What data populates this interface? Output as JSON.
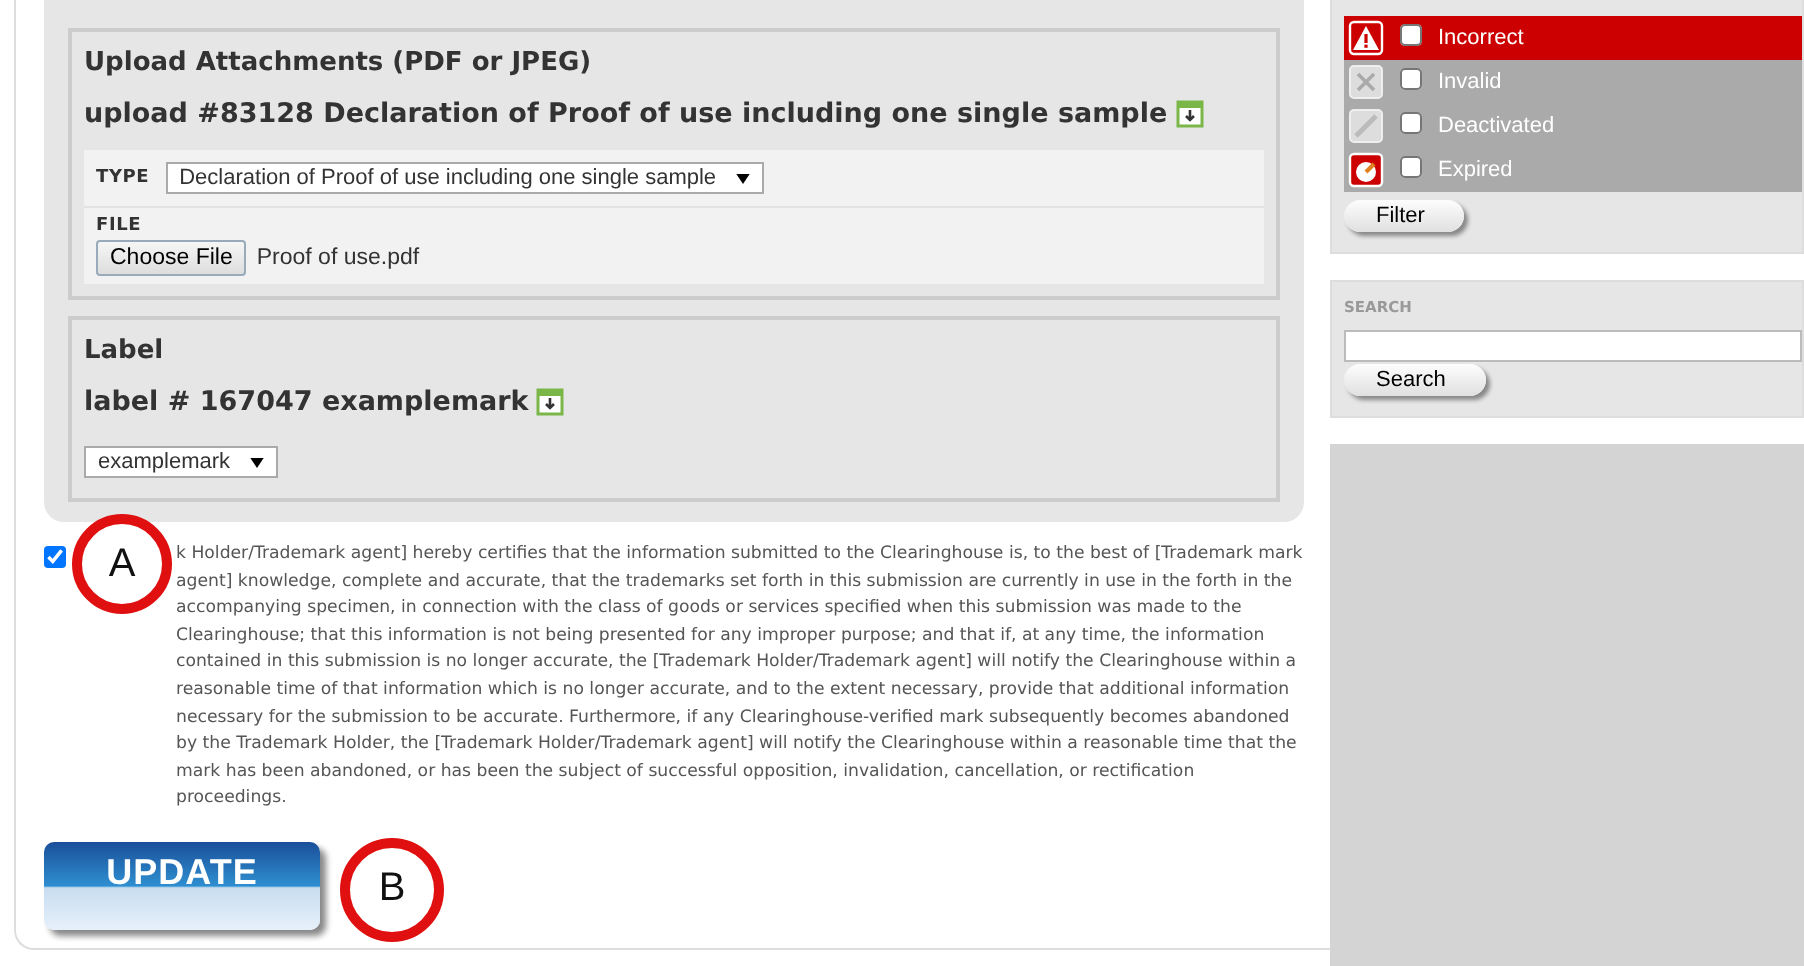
{
  "attachments": {
    "title": "Upload Attachments (PDF or JPEG)",
    "upload_heading": "upload #83128 Declaration of Proof of use including one single sample",
    "type_label": "TYPE",
    "type_value": "Declaration of Proof of use including one single sample",
    "file_label": "FILE",
    "choose_button": "Choose File",
    "file_name": "Proof of use.pdf"
  },
  "label_section": {
    "title": "Label",
    "heading": "label # 167047 examplemark",
    "select_value": "examplemark"
  },
  "certification": {
    "checked": true,
    "text": "k Holder/Trademark agent] hereby certifies that the information submitted to the Clearinghouse is, to the best of [Trademark mark agent] knowledge, complete and accurate, that the trademarks set forth in this submission are currently in use in the forth in the accompanying specimen, in connection with the class of goods or services specified when this submission was made to the Clearinghouse; that this information is not being presented for any improper purpose; and that if, at any time, the information contained in this submission is no longer accurate, the [Trademark Holder/Trademark agent] will notify the Clearinghouse within a reasonable time of that information which is no longer accurate, and to the extent necessary, provide that additional information necessary for the submission to be accurate. Furthermore, if any Clearinghouse-verified mark subsequently becomes abandoned by the Trademark Holder, the [Trademark Holder/Trademark agent] will notify the Clearinghouse within a reasonable time that the mark has been abandoned, or has been the subject of successful opposition, invalidation, cancellation, or rectification proceedings."
  },
  "update_button": "UPDATE",
  "callouts": [
    "A",
    "B"
  ],
  "status_filters": [
    {
      "kind": "warning",
      "label": "Incorrect",
      "checked": false,
      "color": "#cc0000"
    },
    {
      "kind": "cross",
      "label": "Invalid",
      "checked": false,
      "color": "#aaaaaa"
    },
    {
      "kind": "slash",
      "label": "Deactivated",
      "checked": false,
      "color": "#aaaaaa"
    },
    {
      "kind": "clock",
      "label": "Expired",
      "checked": false,
      "color": "#aaaaaa"
    }
  ],
  "filter_button": "Filter",
  "search": {
    "title": "SEARCH",
    "button": "Search"
  }
}
